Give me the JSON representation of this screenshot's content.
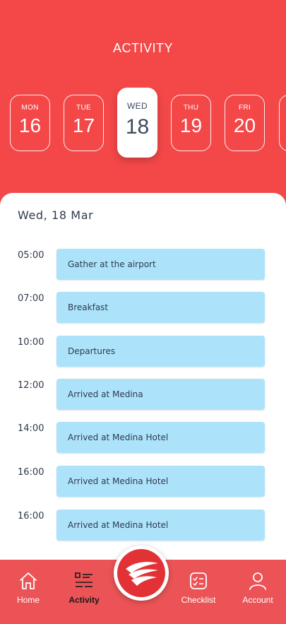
{
  "header": {
    "title": "ACTIVITY"
  },
  "days": [
    {
      "name": "MON",
      "num": "16"
    },
    {
      "name": "TUE",
      "num": "17"
    },
    {
      "name": "WED",
      "num": "18"
    },
    {
      "name": "THU",
      "num": "19"
    },
    {
      "name": "FRI",
      "num": "20"
    }
  ],
  "selected_day_index": 2,
  "schedule": {
    "date": "Wed, 18 Mar",
    "items": [
      {
        "time": "05:00",
        "title": "Gather at the airport"
      },
      {
        "time": "07:00",
        "title": "Breakfast"
      },
      {
        "time": "10:00",
        "title": "Departures"
      },
      {
        "time": "12:00",
        "title": "Arrived at Medina"
      },
      {
        "time": "14:00",
        "title": "Arrived at Medina Hotel"
      },
      {
        "time": "16:00",
        "title": "Arrived at Medina Hotel"
      },
      {
        "time": "16:00",
        "title": "Arrived at Medina Hotel"
      }
    ]
  },
  "nav": {
    "home": "Home",
    "activity": "Activity",
    "checklist": "Checklist",
    "account": "Account",
    "fab_icon": "wing-logo-icon"
  },
  "colors": {
    "brand_red": "#f34748",
    "nav_red": "#ec5356",
    "card_blue": "#ace3fb",
    "text_dark": "#2e3a4d"
  }
}
